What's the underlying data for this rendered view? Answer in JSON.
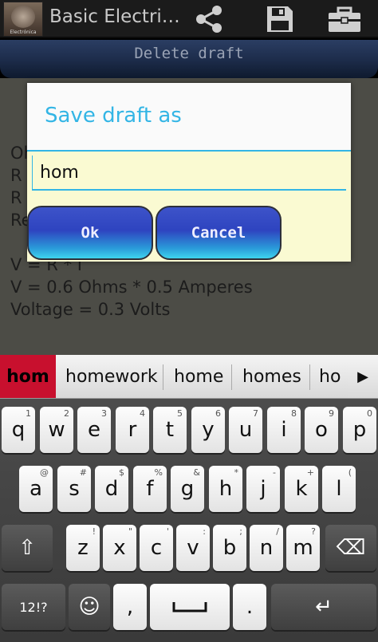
{
  "actionbar": {
    "app_icon_text": "Electrónica",
    "title": "Basic Electri…",
    "icons": [
      "share-icon",
      "save-icon",
      "open-folder-icon"
    ]
  },
  "delete_bar": {
    "label": "Delete draft"
  },
  "content": {
    "lines": [
      "Oh",
      "R",
      "R",
      "Re",
      "V = R * I",
      "V = 0.6 Ohms * 0.5 Amperes",
      "Voltage = 0.3 Volts"
    ]
  },
  "dialog": {
    "title": "Save draft as",
    "input_value": "hom",
    "ok_label": "Ok",
    "cancel_label": "Cancel"
  },
  "suggestions": {
    "items": [
      "hom",
      "homework",
      "home",
      "homes",
      "ho"
    ],
    "arrow": "▶"
  },
  "keyboard": {
    "row1": [
      {
        "k": "q",
        "h": "1"
      },
      {
        "k": "w",
        "h": "2"
      },
      {
        "k": "e",
        "h": "3"
      },
      {
        "k": "r",
        "h": "4"
      },
      {
        "k": "t",
        "h": "5"
      },
      {
        "k": "y",
        "h": "6"
      },
      {
        "k": "u",
        "h": "7"
      },
      {
        "k": "i",
        "h": "8"
      },
      {
        "k": "o",
        "h": "9"
      },
      {
        "k": "p",
        "h": "0"
      }
    ],
    "row2": [
      {
        "k": "a",
        "h": "@"
      },
      {
        "k": "s",
        "h": "#"
      },
      {
        "k": "d",
        "h": "$"
      },
      {
        "k": "f",
        "h": "%"
      },
      {
        "k": "g",
        "h": "&"
      },
      {
        "k": "h",
        "h": "*"
      },
      {
        "k": "j",
        "h": "-"
      },
      {
        "k": "k",
        "h": "+"
      },
      {
        "k": "l",
        "h": "("
      }
    ],
    "row3": [
      {
        "k": "z",
        "h": "!"
      },
      {
        "k": "x",
        "h": "\""
      },
      {
        "k": "c",
        "h": "'"
      },
      {
        "k": "v",
        "h": ":"
      },
      {
        "k": "b",
        "h": ";"
      },
      {
        "k": "n",
        "h": "/"
      },
      {
        "k": "m",
        "h": "?"
      }
    ],
    "shift": "⇧",
    "backspace": "⌫",
    "sym": "12!?",
    "emoji": "☺",
    "comma": ",",
    "period": ".",
    "enter": "↵"
  },
  "colors": {
    "accent": "#33b5e5",
    "suggestion_highlight": "#c8102e"
  }
}
